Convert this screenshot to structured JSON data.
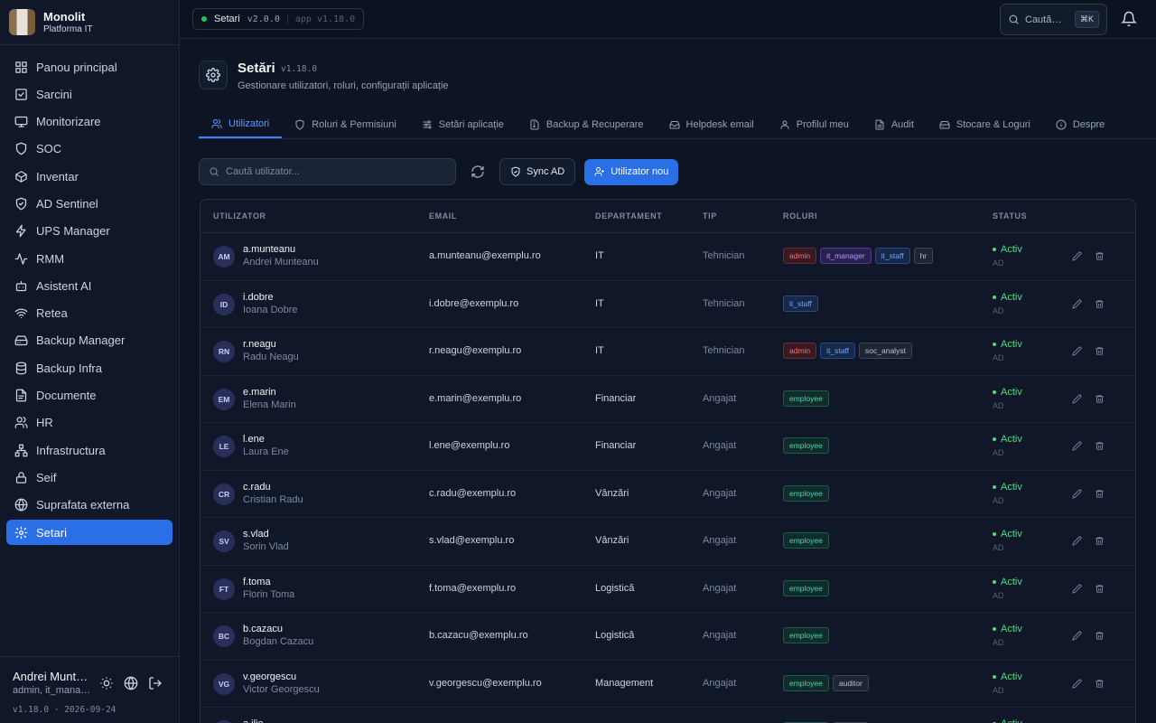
{
  "brand": {
    "name": "Monolit",
    "subtitle": "Platforma IT"
  },
  "sidebar": {
    "items": [
      {
        "label": "Panou principal",
        "icon": "grid-icon"
      },
      {
        "label": "Sarcini",
        "icon": "checkbox-icon"
      },
      {
        "label": "Monitorizare",
        "icon": "monitor-icon"
      },
      {
        "label": "SOC",
        "icon": "shield-icon"
      },
      {
        "label": "Inventar",
        "icon": "box-icon"
      },
      {
        "label": "AD Sentinel",
        "icon": "shield-check-icon"
      },
      {
        "label": "UPS Manager",
        "icon": "bolt-icon"
      },
      {
        "label": "RMM",
        "icon": "activity-icon"
      },
      {
        "label": "Asistent AI",
        "icon": "bot-icon"
      },
      {
        "label": "Retea",
        "icon": "wifi-icon"
      },
      {
        "label": "Backup Manager",
        "icon": "hard-drive-icon"
      },
      {
        "label": "Backup Infra",
        "icon": "database-icon"
      },
      {
        "label": "Documente",
        "icon": "file-icon"
      },
      {
        "label": "HR",
        "icon": "users-icon"
      },
      {
        "label": "Infrastructura",
        "icon": "network-icon"
      },
      {
        "label": "Seif",
        "icon": "lock-icon"
      },
      {
        "label": "Suprafata externa",
        "icon": "globe-icon"
      },
      {
        "label": "Setari",
        "icon": "gear-icon",
        "active": true
      }
    ],
    "user": {
      "name": "Andrei Munteanu",
      "roles": "admin, it_manager, it_staff, hr"
    },
    "version": "v1.18.0 · 2026-09-24"
  },
  "topbar": {
    "env_label": "Setari",
    "env_version": "v2.0.0",
    "app_version": "app v1.18.0",
    "search_placeholder": "Caută…",
    "shortcut": "⌘K"
  },
  "page": {
    "title": "Setări",
    "version": "v1.18.0",
    "subtitle": "Gestionare utilizatori, roluri, configurații aplicație"
  },
  "tabs": [
    {
      "label": "Utilizatori",
      "icon": "users-icon",
      "active": true
    },
    {
      "label": "Roluri & Permisiuni",
      "icon": "shield-icon"
    },
    {
      "label": "Setări aplicație",
      "icon": "sliders-icon"
    },
    {
      "label": "Backup & Recuperare",
      "icon": "file-archive-icon"
    },
    {
      "label": "Helpdesk email",
      "icon": "inbox-icon"
    },
    {
      "label": "Profilul meu",
      "icon": "user-icon"
    },
    {
      "label": "Audit",
      "icon": "file-text-icon"
    },
    {
      "label": "Stocare & Loguri",
      "icon": "hard-drive-icon"
    },
    {
      "label": "Despre",
      "icon": "info-icon"
    }
  ],
  "toolbar": {
    "search_placeholder": "Caută utilizator...",
    "sync_label": "Sync AD",
    "new_user_label": "Utilizator nou"
  },
  "table": {
    "headers": {
      "user": "UTILIZATOR",
      "email": "EMAIL",
      "department": "DEPARTAMENT",
      "type": "TIP",
      "roles": "ROLURI",
      "status": "STATUS"
    },
    "rows": [
      {
        "initials": "AM",
        "login": "a.munteanu",
        "name": "Andrei Munteanu",
        "email": "a.munteanu@exemplu.ro",
        "department": "IT",
        "type": "Tehnician",
        "roles": [
          "admin",
          "it_manager",
          "it_staff",
          "hr"
        ],
        "status": "Activ",
        "source": "AD"
      },
      {
        "initials": "ID",
        "login": "i.dobre",
        "name": "Ioana Dobre",
        "email": "i.dobre@exemplu.ro",
        "department": "IT",
        "type": "Tehnician",
        "roles": [
          "it_staff"
        ],
        "status": "Activ",
        "source": "AD"
      },
      {
        "initials": "RN",
        "login": "r.neagu",
        "name": "Radu Neagu",
        "email": "r.neagu@exemplu.ro",
        "department": "IT",
        "type": "Tehnician",
        "roles": [
          "admin",
          "it_staff",
          "soc_analyst"
        ],
        "status": "Activ",
        "source": "AD"
      },
      {
        "initials": "EM",
        "login": "e.marin",
        "name": "Elena Marin",
        "email": "e.marin@exemplu.ro",
        "department": "Financiar",
        "type": "Angajat",
        "roles": [
          "employee"
        ],
        "status": "Activ",
        "source": "AD"
      },
      {
        "initials": "LE",
        "login": "l.ene",
        "name": "Laura Ene",
        "email": "l.ene@exemplu.ro",
        "department": "Financiar",
        "type": "Angajat",
        "roles": [
          "employee"
        ],
        "status": "Activ",
        "source": "AD"
      },
      {
        "initials": "CR",
        "login": "c.radu",
        "name": "Cristian Radu",
        "email": "c.radu@exemplu.ro",
        "department": "Vânzări",
        "type": "Angajat",
        "roles": [
          "employee"
        ],
        "status": "Activ",
        "source": "AD"
      },
      {
        "initials": "SV",
        "login": "s.vlad",
        "name": "Sorin Vlad",
        "email": "s.vlad@exemplu.ro",
        "department": "Vânzări",
        "type": "Angajat",
        "roles": [
          "employee"
        ],
        "status": "Activ",
        "source": "AD"
      },
      {
        "initials": "FT",
        "login": "f.toma",
        "name": "Florin Toma",
        "email": "f.toma@exemplu.ro",
        "department": "Logistică",
        "type": "Angajat",
        "roles": [
          "employee"
        ],
        "status": "Activ",
        "source": "AD"
      },
      {
        "initials": "BC",
        "login": "b.cazacu",
        "name": "Bogdan Cazacu",
        "email": "b.cazacu@exemplu.ro",
        "department": "Logistică",
        "type": "Angajat",
        "roles": [
          "employee"
        ],
        "status": "Activ",
        "source": "AD"
      },
      {
        "initials": "VG",
        "login": "v.georgescu",
        "name": "Victor Georgescu",
        "email": "v.georgescu@exemplu.ro",
        "department": "Management",
        "type": "Angajat",
        "roles": [
          "employee",
          "auditor"
        ],
        "status": "Activ",
        "source": "AD"
      },
      {
        "initials": "AI",
        "login": "a.ilie",
        "name": "",
        "email": "",
        "department": "",
        "type": "",
        "roles": [
          "employee",
          "auditor"
        ],
        "status": "Activ",
        "source": ""
      }
    ]
  },
  "colors": {
    "accent": "#2b6fe6",
    "active_status": "#4ade80",
    "background": "#0d1424"
  }
}
